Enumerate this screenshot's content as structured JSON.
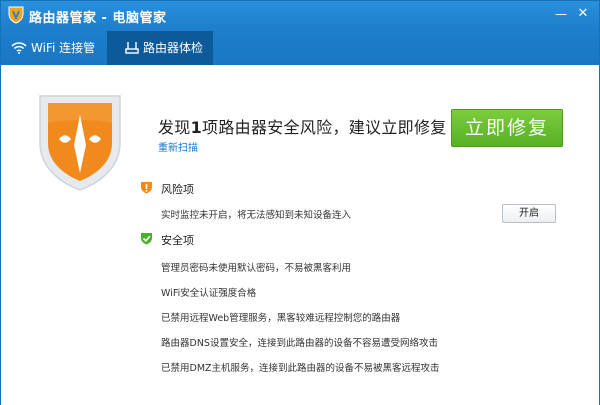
{
  "window": {
    "title": "路由器管家 - 电脑管家",
    "minimize": "—",
    "close": "✕"
  },
  "tabs": [
    {
      "label": "WiFi 连接管理",
      "icon": "wifi-icon"
    },
    {
      "label": "路由器体检",
      "icon": "router-icon",
      "active": true
    }
  ],
  "result": {
    "headline_prefix": "发现",
    "risk_count": "1",
    "headline_suffix": "项路由器安全风险，建议立即修复",
    "rescan_label": "重新扫描",
    "fix_button_label": "立即修复"
  },
  "risk_section": {
    "title": "风险项",
    "icon": "warning-shield-icon",
    "items": [
      {
        "text": "实时监控未开启，将无法感知到未知设备连入",
        "button_label": "开启"
      }
    ]
  },
  "safe_section": {
    "title": "安全项",
    "icon": "check-shield-icon",
    "items": [
      "管理员密码未使用默认密码，不易被黑客利用",
      "WiFi安全认证强度合格",
      "已禁用远程Web管理服务，黑客较难远程控制您的路由器",
      "路由器DNS设置安全，连接到此路由器的设备不容易遭受网络攻击",
      "已禁用DMZ主机服务，连接到此路由器的设备不易被黑客远程攻击"
    ]
  },
  "colors": {
    "titlebar": "#1d7fcd",
    "active_tab": "#0d5a9a",
    "fix_button": "#66bb2c",
    "shield_orange": "#f08a1c",
    "link": "#1a74c6"
  }
}
